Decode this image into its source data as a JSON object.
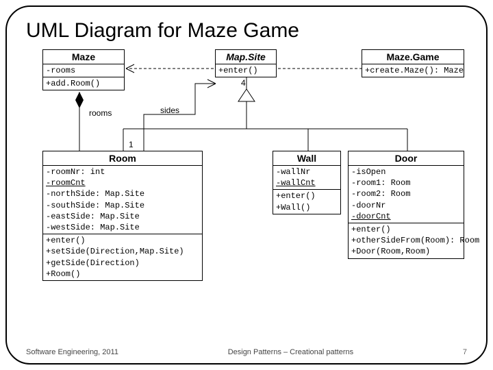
{
  "title": "UML Diagram for Maze Game",
  "labels": {
    "rooms": "rooms",
    "sides": "sides",
    "mult1": "1",
    "mult4": "4"
  },
  "classes": {
    "maze": {
      "name": "Maze",
      "attrs": [
        "-rooms"
      ],
      "ops": [
        "+add.Room()"
      ]
    },
    "mapsite": {
      "name": "Map.Site",
      "ops": [
        "+enter()"
      ]
    },
    "mazegame": {
      "name": "Maze.Game",
      "ops": [
        "+create.Maze(): Maze"
      ]
    },
    "room": {
      "name": "Room",
      "attrs": [
        "-roomNr: int",
        "-roomCnt",
        "-northSide: Map.Site",
        "-southSide: Map.Site",
        "-eastSide: Map.Site",
        "-westSide: Map.Site"
      ],
      "ops": [
        "+enter()",
        "+setSide(Direction,Map.Site)",
        "+getSide(Direction)",
        "+Room()"
      ]
    },
    "wall": {
      "name": "Wall",
      "attrs": [
        "-wallNr",
        "-wallCnt"
      ],
      "ops": [
        "+enter()",
        "+Wall()"
      ]
    },
    "door": {
      "name": "Door",
      "attrs": [
        "-isOpen",
        "-room1: Room",
        "-room2: Room",
        "-doorNr",
        "-doorCnt"
      ],
      "ops": [
        "+enter()",
        "+otherSideFrom(Room): Room",
        "+Door(Room,Room)"
      ]
    }
  },
  "footer": {
    "left": "Software Engineering, 2011",
    "center": "Design Patterns – Creational patterns",
    "page": "7"
  }
}
